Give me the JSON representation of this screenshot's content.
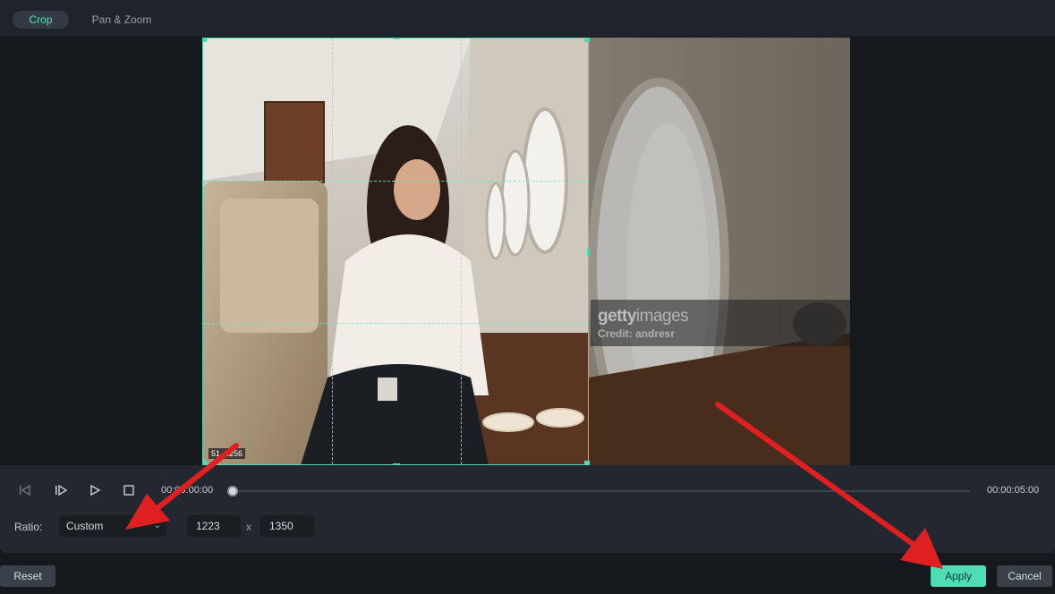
{
  "tabs": [
    {
      "label": "Crop",
      "active": true
    },
    {
      "label": "Pan & Zoom",
      "active": false
    }
  ],
  "preview": {
    "watermark_brand_bold": "getty",
    "watermark_brand_light": "images",
    "watermark_credit": "Credit: andresr",
    "crop_size_label": "51  1256"
  },
  "playback": {
    "current_time": "00:00:00:00",
    "total_time": "00:00:05:00",
    "progress": 0,
    "icons": [
      "prev-frame-icon",
      "play-step-icon",
      "play-icon",
      "stop-icon"
    ]
  },
  "ratio": {
    "label": "Ratio:",
    "selected": "Custom",
    "width": "1223",
    "times": "x",
    "height": "1350"
  },
  "buttons": {
    "reset": "Reset",
    "apply": "Apply",
    "cancel": "Cancel"
  },
  "colors": {
    "accent": "#4fdcb6",
    "annotation_arrow": "#e02020"
  }
}
